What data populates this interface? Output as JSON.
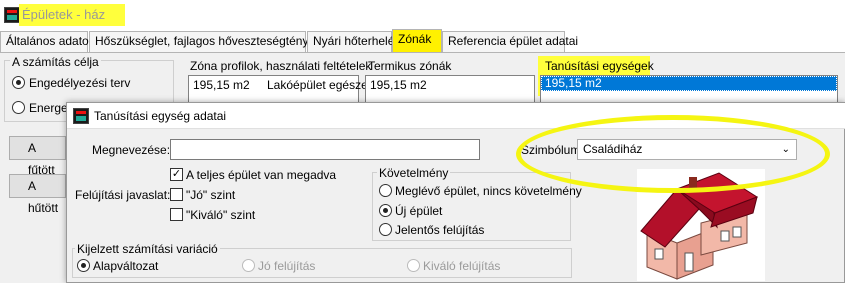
{
  "window": {
    "title": "Épületek - ház"
  },
  "tabs": [
    {
      "label": "Általános adatok"
    },
    {
      "label": "Hőszükséglet, fajlagos hőveszteségtényező"
    },
    {
      "label": "Nyári hőterhelés"
    },
    {
      "label": "Zónák"
    },
    {
      "label": "Referencia épület adatai"
    }
  ],
  "purpose": {
    "group_label": "A számítás célja",
    "option1": "Engedélyezési terv",
    "option2": "Energeti"
  },
  "zones": {
    "profiles_label": "Zóna profilok, használati feltételek",
    "profiles_area": "195,15 m2",
    "profiles_name": "Lakóépület egésze",
    "thermal_label": "Termikus zónák",
    "thermal_area": "195,15 m2",
    "cert_label": "Tanúsítási egységek",
    "cert_area": "195,15 m2"
  },
  "left_buttons": {
    "heating": "A fűtött",
    "cooling": "A hűtött"
  },
  "dialog": {
    "title": "Tanúsítási egység adatai",
    "name_label": "Megnevezése:",
    "name_value": "",
    "symbol_label": "Szimbólum:",
    "symbol_value": "Családiház",
    "full_building_label": "A teljes épület van megadva",
    "renovation_label": "Felújítási javaslat:",
    "jo_label": "\"Jó\" szint",
    "kivalo_label": "\"Kiváló\" szint",
    "requirement_group": "Követelmény",
    "req_option1": "Meglévő épület, nincs követelmény",
    "req_option2": "Új épület",
    "req_option3": "Jelentős felújítás",
    "variant_group": "Kijelzett számítási variáció",
    "variant1": "Alapváltozat",
    "variant2": "Jó felújítás",
    "variant3": "Kiváló felújítás"
  },
  "colors": {
    "highlight": "#ffff3c",
    "selection": "#0078d7",
    "roof": "#b3102a",
    "wall": "#f2b8a8"
  }
}
